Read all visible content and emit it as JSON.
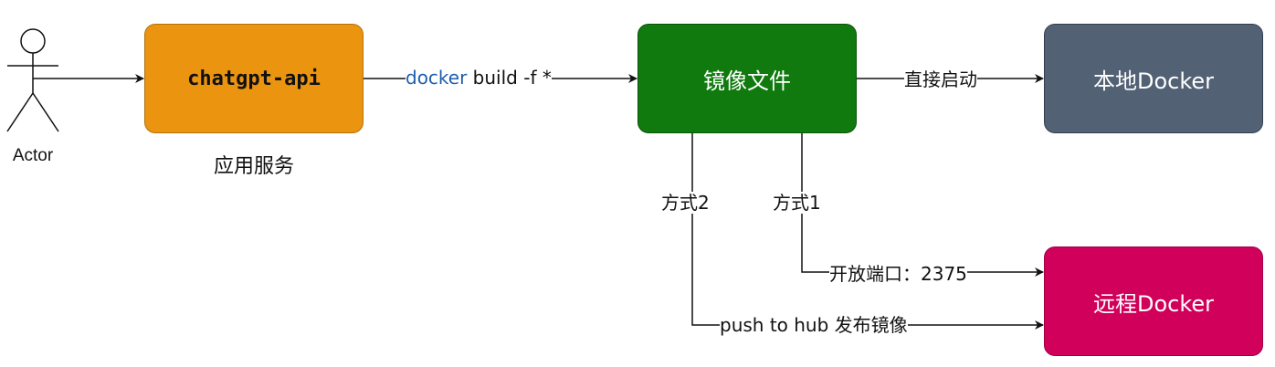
{
  "actor": {
    "label": "Actor"
  },
  "nodes": {
    "chatgpt_api": {
      "label": "chatgpt-api",
      "caption": "应用服务",
      "color": "#ea940f"
    },
    "image_file": {
      "label": "镜像文件",
      "color": "#107a0e"
    },
    "local_docker": {
      "label": "本地Docker",
      "color": "#526174"
    },
    "remote_docker": {
      "label": "远程Docker",
      "color": "#d1005a"
    }
  },
  "edges": {
    "docker_build": {
      "keyword": "docker",
      "rest": " build -f *"
    },
    "direct_start": {
      "label": "直接启动"
    },
    "method2": {
      "label": "方式2"
    },
    "method1": {
      "label": "方式1"
    },
    "open_port": {
      "label": "开放端口：2375"
    },
    "push_hub": {
      "label": "push to hub 发布镜像"
    }
  }
}
